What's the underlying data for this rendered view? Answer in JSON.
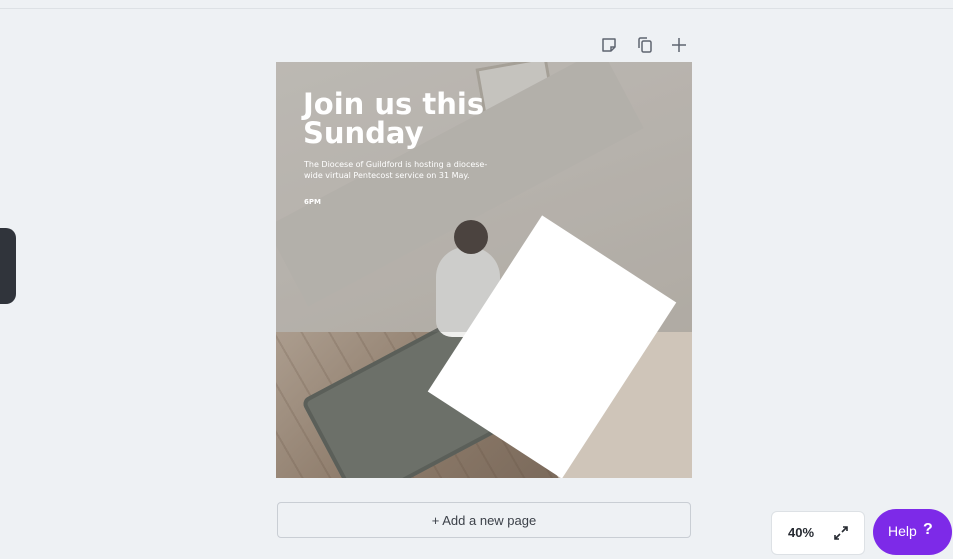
{
  "design": {
    "headline": "Join us this Sunday",
    "subtext": "The Diocese of Guildford is hosting a diocese-wide virtual Pentecost service on 31 May.",
    "time": "6PM"
  },
  "canvas_toolbar": {
    "icons": [
      "note-icon",
      "duplicate-page-icon",
      "add-page-plus-icon"
    ]
  },
  "add_page_label": "+ Add a new page",
  "zoom": {
    "value": "40%"
  },
  "help": {
    "label": "Help",
    "mark": "?"
  },
  "colors": {
    "help_accent": "#7d2ae8",
    "workspace_bg": "#eef1f4"
  }
}
